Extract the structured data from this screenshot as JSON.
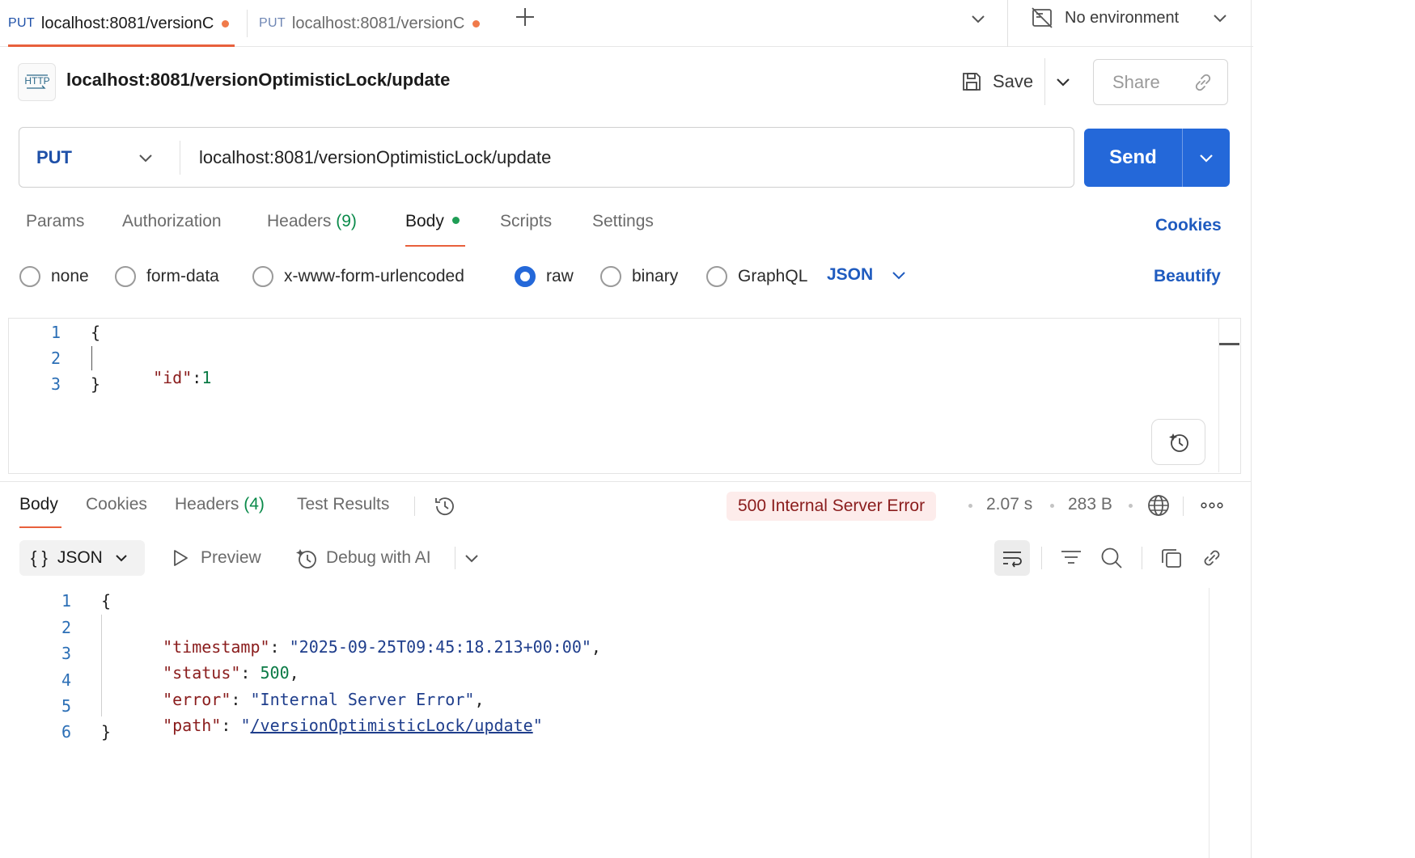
{
  "colors": {
    "accent_blue": "#2468d9",
    "method_put": "#1e50a8",
    "tab_active_underline": "#e8603c",
    "unsaved_dot": "#f07a4a",
    "body_dot": "#1f9d55",
    "error_badge_bg": "#fdeceb",
    "error_badge_text": "#8a1c1c",
    "link_blue": "#1f5bbf"
  },
  "tabs": [
    {
      "method": "PUT",
      "title": "localhost:8081/versionC",
      "active": true,
      "unsaved": true
    },
    {
      "method": "PUT",
      "title": "localhost:8081/versionC",
      "active": false,
      "unsaved": true
    }
  ],
  "tabbar": {
    "new_tab_icon": "plus-icon",
    "tabs_menu_icon": "chevron-down-icon"
  },
  "environment": {
    "label": "No environment",
    "icon": "no-environment-icon"
  },
  "request": {
    "badge": "HTTP",
    "title": "localhost:8081/versionOptimisticLock/update",
    "save_label": "Save",
    "share_label": "Share",
    "method": "PUT",
    "url": "localhost:8081/versionOptimisticLock/update",
    "send_label": "Send"
  },
  "request_tabs": {
    "params": "Params",
    "authorization": "Authorization",
    "headers": "Headers",
    "headers_count": "(9)",
    "body": "Body",
    "scripts": "Scripts",
    "settings": "Settings",
    "cookies": "Cookies"
  },
  "body_modes": {
    "options": [
      "none",
      "form-data",
      "x-www-form-urlencoded",
      "raw",
      "binary",
      "GraphQL"
    ],
    "selected": "raw",
    "format": "JSON",
    "beautify": "Beautify"
  },
  "request_body": {
    "line_numbers": [
      "1",
      "2",
      "3"
    ],
    "line1": "{",
    "line2_key": "\"id\"",
    "line2_colon": ":",
    "line2_value": "1",
    "line3": "}"
  },
  "response_tabs": {
    "body": "Body",
    "cookies": "Cookies",
    "headers": "Headers",
    "headers_count": "(4)",
    "test_results": "Test Results"
  },
  "response_meta": {
    "status": "500 Internal Server Error",
    "time": "2.07 s",
    "size": "283 B"
  },
  "response_toolbar": {
    "format": "JSON",
    "format_icon": "{ }",
    "preview": "Preview",
    "debug": "Debug with AI"
  },
  "response_body": {
    "line_numbers": [
      "1",
      "2",
      "3",
      "4",
      "5",
      "6"
    ],
    "open": "{",
    "close": "}",
    "entries": [
      {
        "key": "\"timestamp\"",
        "value": "\"2025-09-25T09:45:18.213+00:00\"",
        "type": "string",
        "comma": ","
      },
      {
        "key": "\"status\"",
        "value": "500",
        "type": "number",
        "comma": ","
      },
      {
        "key": "\"error\"",
        "value": "\"Internal Server Error\"",
        "type": "string",
        "comma": ","
      },
      {
        "key": "\"path\"",
        "value": "/versionOptimisticLock/update",
        "type": "link",
        "comma": ""
      }
    ]
  }
}
